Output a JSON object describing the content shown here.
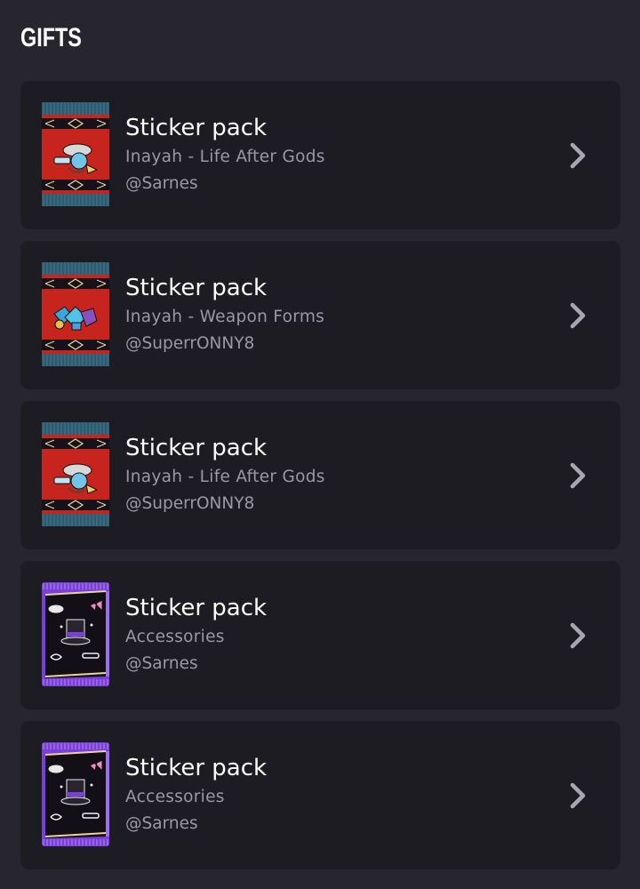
{
  "header": {
    "title": "GIFTS"
  },
  "gifts": [
    {
      "title": "Sticker pack",
      "pack": "Inayah - Life After Gods",
      "author": "@Sarnes",
      "thumb": "inayah-life"
    },
    {
      "title": "Sticker pack",
      "pack": "Inayah - Weapon Forms",
      "author": "@SuperrONNY8",
      "thumb": "inayah-weapon"
    },
    {
      "title": "Sticker pack",
      "pack": "Inayah - Life After Gods",
      "author": "@SuperrONNY8",
      "thumb": "inayah-life"
    },
    {
      "title": "Sticker pack",
      "pack": "Accessories",
      "author": "@Sarnes",
      "thumb": "accessories"
    },
    {
      "title": "Sticker pack",
      "pack": "Accessories",
      "author": "@Sarnes",
      "thumb": "accessories"
    }
  ],
  "icons": {
    "chevron": "chevron-right-icon"
  },
  "colors": {
    "background": "#27252d",
    "card": "#1e1c23",
    "secondary_text": "#9b98a4",
    "chevron": "#a9a6b1"
  }
}
